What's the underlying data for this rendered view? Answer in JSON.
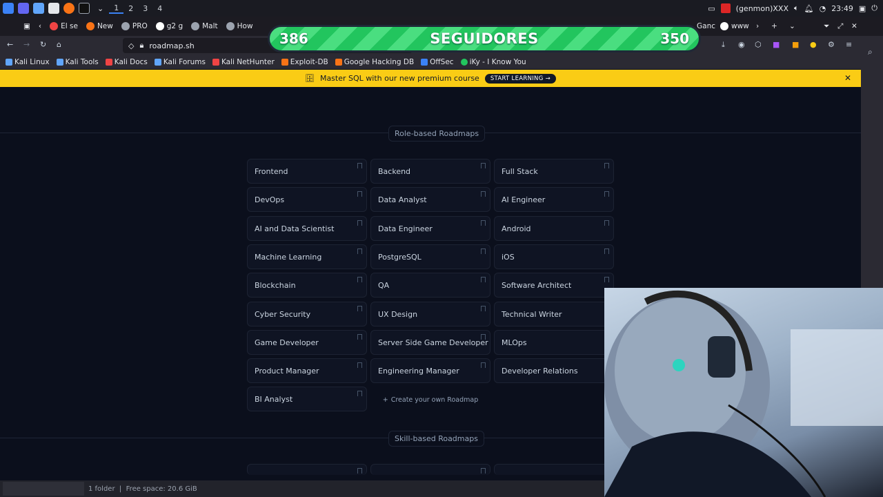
{
  "os_taskbar": {
    "workspaces": [
      "1",
      "2",
      "3",
      "4"
    ],
    "active_workspace": "1",
    "tray": {
      "user": "(genmon)XXX",
      "time": "23:49"
    }
  },
  "browser_tabs": [
    {
      "label": "El se"
    },
    {
      "label": "New"
    },
    {
      "label": "PRO"
    },
    {
      "label": "g2 g"
    },
    {
      "label": "Malt"
    },
    {
      "label": "How"
    },
    {
      "label": "Ganc"
    },
    {
      "label": "www"
    }
  ],
  "navbar": {
    "url": "roadmap.sh"
  },
  "bookmarks": [
    {
      "label": "Kali Linux",
      "color": "#60a5fa"
    },
    {
      "label": "Kali Tools",
      "color": "#60a5fa"
    },
    {
      "label": "Kali Docs",
      "color": "#ef4444"
    },
    {
      "label": "Kali Forums",
      "color": "#60a5fa"
    },
    {
      "label": "Kali NetHunter",
      "color": "#ef4444"
    },
    {
      "label": "Exploit-DB",
      "color": "#f97316"
    },
    {
      "label": "Google Hacking DB",
      "color": "#f97316"
    },
    {
      "label": "OffSec",
      "color": "#3b82f6"
    },
    {
      "label": "iKy - I Know You",
      "color": "#22c55e"
    }
  ],
  "banner": {
    "text": "Master SQL with our new premium course",
    "cta": "START LEARNING →",
    "close": "✕"
  },
  "page": {
    "role_label": "Role-based Roadmaps",
    "skill_label": "Skill-based Roadmaps",
    "roles": [
      "Frontend",
      "Backend",
      "Full Stack",
      "DevOps",
      "Data Analyst",
      "AI Engineer",
      "AI and Data Scientist",
      "Data Engineer",
      "Android",
      "Machine Learning",
      "PostgreSQL",
      "iOS",
      "Blockchain",
      "QA",
      "Software Architect",
      "Cyber Security",
      "UX Design",
      "Technical Writer",
      "Game Developer",
      "Server Side Game Developer",
      "MLOps",
      "Product Manager",
      "Engineering Manager",
      "Developer Relations",
      "BI Analyst"
    ],
    "create_label": "Create your own Roadmap"
  },
  "overlay": {
    "left_count": "386",
    "title": "SEGUIDORES",
    "right_count": "350"
  },
  "status": {
    "text": "1 folder  |  Free space: 20.6 GiB"
  }
}
